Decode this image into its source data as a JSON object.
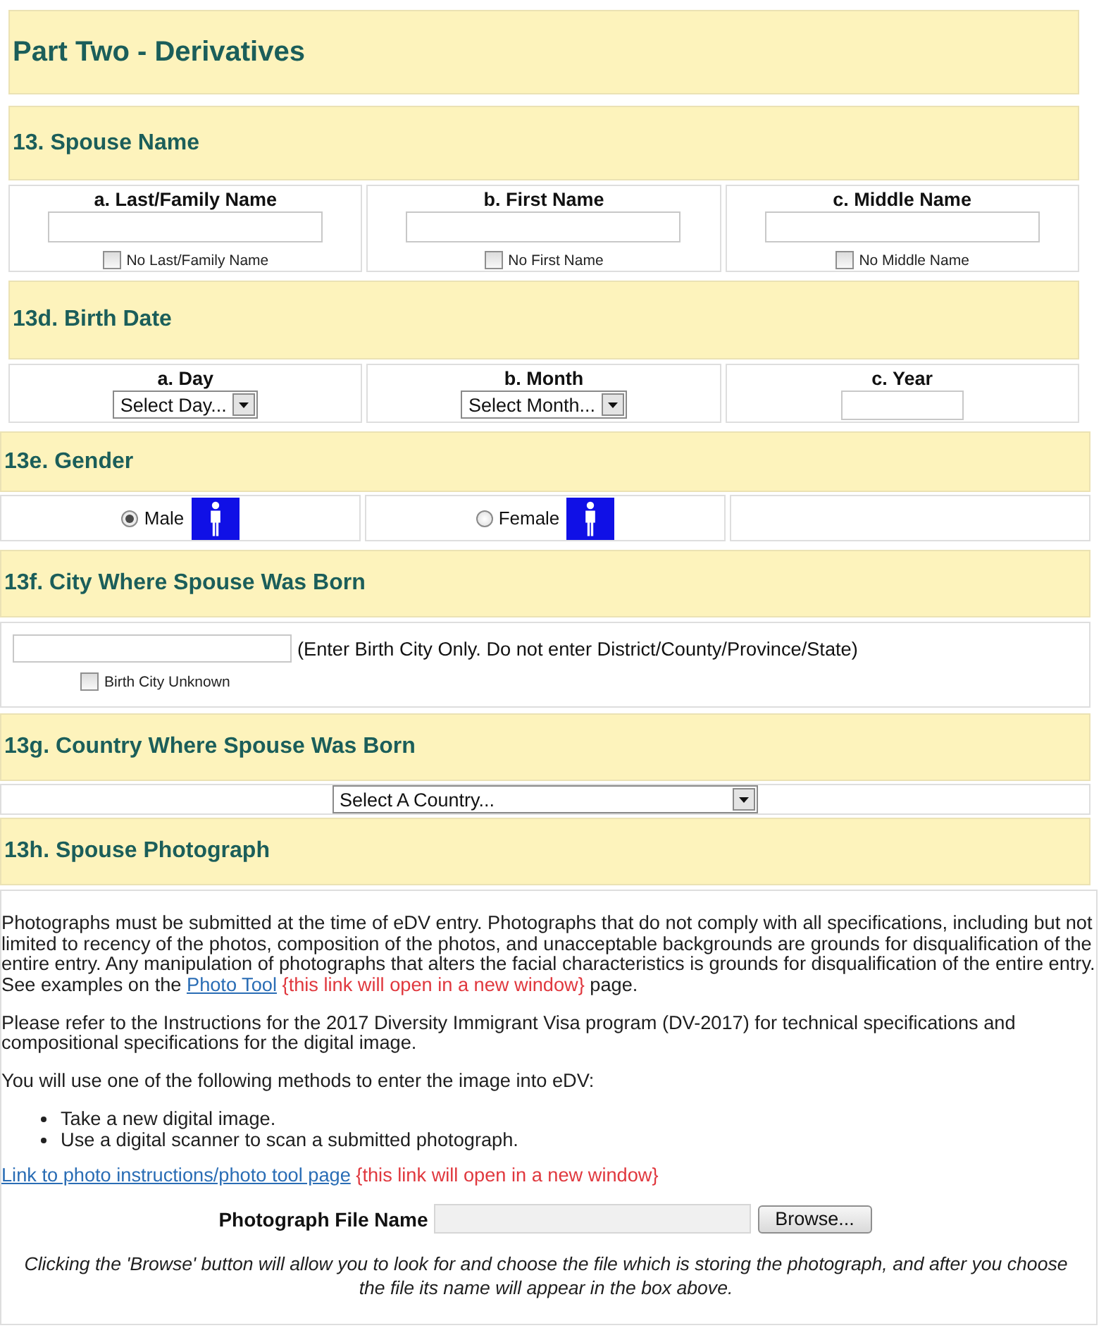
{
  "page_title": "Part Two - Derivatives",
  "sections": [
    {
      "kind": "name",
      "heading": "13. Spouse Name",
      "fields": [
        {
          "label": "a. Last/Family Name",
          "checkbox": {
            "label": "No Last/Family Name",
            "checked": false
          }
        },
        {
          "label": "b. First Name",
          "checkbox": {
            "label": "No First Name",
            "checked": false
          }
        },
        {
          "label": "c. Middle Name",
          "checkbox": {
            "label": "No Middle Name",
            "checked": false
          }
        }
      ]
    },
    {
      "kind": "date",
      "heading": "13d. Birth Date",
      "fields": [
        {
          "kind": "select",
          "label": "a. Day",
          "value": "Select Day..."
        },
        {
          "kind": "select",
          "label": "b. Month",
          "value": "Select Month..."
        },
        {
          "kind": "text",
          "label": "c. Year"
        }
      ]
    },
    {
      "kind": "gender",
      "heading": "13e. Gender",
      "options": [
        {
          "label": "Male",
          "selected": true
        },
        {
          "label": "Female",
          "selected": false
        }
      ]
    },
    {
      "kind": "city",
      "heading": "13f. City Where Spouse Was Born",
      "hint": "(Enter Birth City Only. Do not enter District/County/Province/State)",
      "checkbox": {
        "label": "Birth City Unknown",
        "checked": false
      }
    },
    {
      "kind": "country",
      "heading": "13g. Country Where Spouse Was Born",
      "select_value": "Select A Country..."
    },
    {
      "kind": "photo",
      "heading": "13h. Spouse Photograph",
      "blocks": [
        {
          "kind": "paragraph",
          "parts": [
            {
              "kind": "text",
              "text": "Photographs must be submitted at the time of eDV entry. Photographs that do not comply with all specifications, including but not limited to recency of the photos, composition of the photos, and unacceptable backgrounds are grounds for disqualification of the entire entry. Any manipulation of photographs that alters the facial characteristics is grounds for disqualification of the entire entry. See examples on the"
            },
            {
              "kind": "link",
              "text": "Photo Tool"
            },
            {
              "kind": "note",
              "text": "{this link will open in a new window}"
            },
            {
              "kind": "text",
              "text": "page."
            }
          ]
        },
        {
          "kind": "paragraph",
          "parts": [
            {
              "kind": "text",
              "text": "Please refer to the Instructions for the 2017 Diversity Immigrant Visa program (DV-2017) for technical specifications and compositional specifications for the digital image."
            }
          ]
        },
        {
          "kind": "paragraph",
          "parts": [
            {
              "kind": "text",
              "text": "You will use one of the following methods to enter the image into eDV:"
            }
          ]
        },
        {
          "kind": "list",
          "items": [
            "Take a new digital image.",
            "Use a digital scanner to scan a submitted photograph."
          ]
        },
        {
          "kind": "paragraph",
          "parts": [
            {
              "kind": "link",
              "text": "Link to photo instructions/photo tool page"
            },
            {
              "kind": "note",
              "text": "{this link will open in a new window}"
            }
          ]
        },
        {
          "kind": "file_input",
          "label": "Photograph File Name",
          "button": "Browse..."
        },
        {
          "kind": "note",
          "text": "Clicking the 'Browse' button will allow you to look for and choose the file which is storing the photograph, and after you choose the file its name will appear in the box above."
        }
      ]
    }
  ]
}
